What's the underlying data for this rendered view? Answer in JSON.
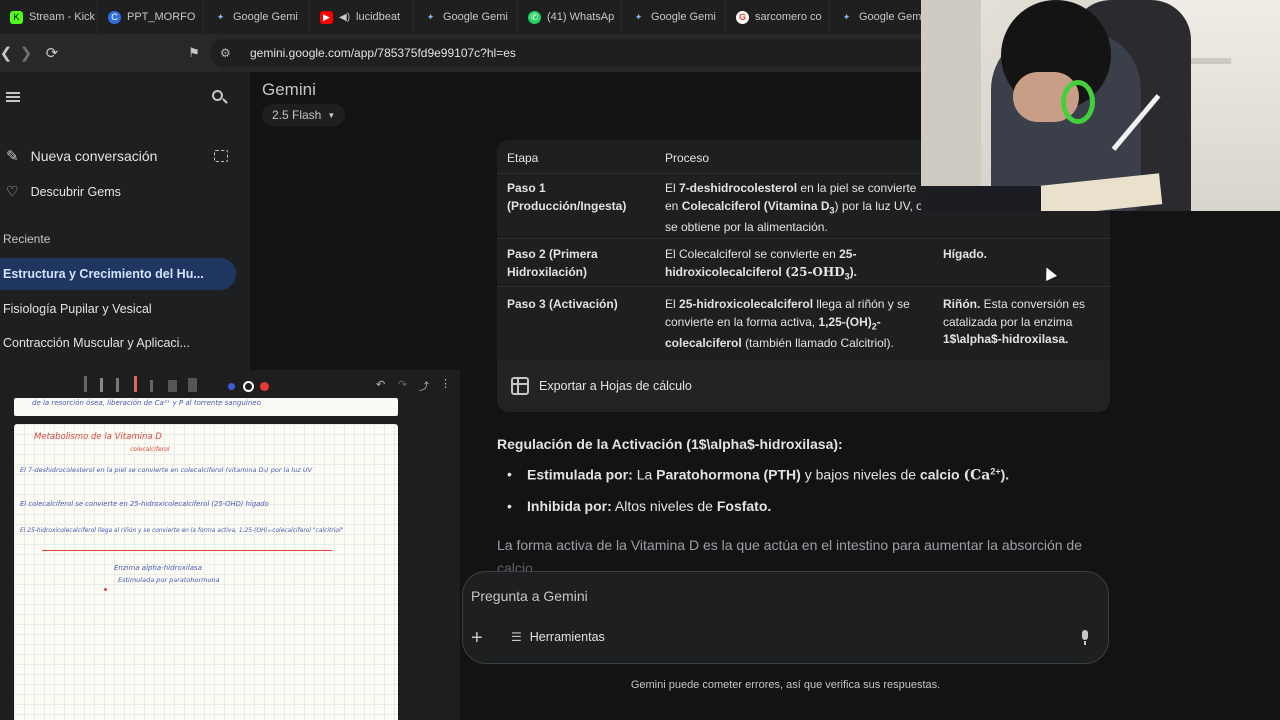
{
  "browser": {
    "tabs": [
      {
        "label": "Stream - Kick",
        "icon": "kick-icon",
        "color": "#53fc18"
      },
      {
        "label": "PPT_MORFO",
        "icon": "canva-icon",
        "color": "#2f6fe0"
      },
      {
        "label": "Google Gemi",
        "icon": "gemini-icon",
        "color": "#8ab4f8"
      },
      {
        "label": "lucidbeat",
        "icon": "youtube-icon",
        "color": "#ff0000"
      },
      {
        "label": "Google Gemi",
        "icon": "gemini-icon",
        "color": "#8ab4f8"
      },
      {
        "label": "(41) WhatsAp",
        "icon": "whatsapp-icon",
        "color": "#25d366"
      },
      {
        "label": "Google Gemi",
        "icon": "gemini-icon",
        "color": "#8ab4f8"
      },
      {
        "label": "sarcomero co",
        "icon": "google-icon",
        "color": "#ea4335"
      },
      {
        "label": "Google Gemi",
        "icon": "gemini-icon",
        "color": "#8ab4f8"
      }
    ],
    "url": "gemini.google.com/app/785375fd9e99107c?hl=es"
  },
  "sidebar": {
    "new_chat": "Nueva conversación",
    "discover": "Descubrir Gems",
    "recent_label": "Reciente",
    "recent": [
      {
        "label": "Estructura y Crecimiento del Hu...",
        "active": true
      },
      {
        "label": "Fisiología Pupilar y Vesical",
        "active": false
      },
      {
        "label": "Contracción Muscular y Aplicaci...",
        "active": false
      }
    ]
  },
  "header": {
    "title": "Gemini",
    "model": "2.5 Flash"
  },
  "table": {
    "headers": [
      "Etapa",
      "Proceso"
    ],
    "rows": [
      {
        "stage": "Paso 1 (Producción/Ingesta)",
        "process_bold1": "7-deshidrocolesterol",
        "process_pre": "El",
        "process_mid": "en la piel se convierte en",
        "process_bold2": "Colecalciferol (Vitamina D",
        "process_sub": "3",
        "process_end": ") por la luz UV, o se obtiene por la alimentación.",
        "location": ""
      },
      {
        "stage": "Paso 2 (Primera Hidroxilación)",
        "process_pre": "El Colecalciferol se convierte en",
        "process_bold1": "25-hidroxicolecalciferol",
        "process_formula": "(25-OHD",
        "process_sub": "3",
        "process_end": ").",
        "location": "Hígado."
      },
      {
        "stage": "Paso 3 (Activación)",
        "process_pre": "El",
        "process_bold1": "25-hidroxicolecalciferol",
        "process_mid": "llega al riñón y se convierte en la forma activa,",
        "process_bold2": "1,25-(OH)",
        "process_sub": "2",
        "process_bold3": "-colecalciferol",
        "process_end": "(también llamado Calcitriol).",
        "location_bold": "Riñón.",
        "location_rest": "Esta conversión es catalizada por la enzima",
        "location_enzyme": "1$\\alpha$-hidroxilasa."
      }
    ],
    "export_label": "Exportar a Hojas de cálculo"
  },
  "response": {
    "heading": "Regulación de la Activación (1$\\alpha$-hidroxilasa):",
    "bullet1_bold": "Estimulada por:",
    "bullet1_pre": "La",
    "bullet1_bold2": "Paratohormona (PTH)",
    "bullet1_mid": "y bajos niveles de",
    "bullet1_bold3": "calcio",
    "bullet1_formula": "(Ca",
    "bullet1_sup": "2+",
    "bullet1_end": ").",
    "bullet2_bold": "Inhibida por:",
    "bullet2_pre": "Altos niveles de",
    "bullet2_bold2": "Fosfato.",
    "closing": "La forma activa de la Vitamina D es la que actúa en el intestino para aumentar la absorción de",
    "closing2": "calcio"
  },
  "input": {
    "placeholder": "Pregunta a Gemini",
    "tools_label": "Herramientas"
  },
  "disclaimer": "Gemini puede cometer errores, así que verifica sus respuestas.",
  "notes": {
    "paper_top": "de la resorción ósea, liberación de Ca²⁺ y P al torrente sanguíneo",
    "lines": [
      {
        "text": "Metabolismo de la Vitamina D",
        "color": "red"
      },
      {
        "text": "colecalciferol",
        "color": "blue"
      },
      {
        "text": "El 7-deshidrocolesterol en la piel se convierte en colecalciferol (vitamina D₃) por la luz UV",
        "color": "blue"
      },
      {
        "text": "El colecalciferol se convierte en 25-hidroxicolecalciferol (25-OHD) hígado",
        "color": "blue"
      },
      {
        "text": "El 25-hidroxicolecalciferol llega al riñón y se convierte en la forma activa, 1,25-(OH)₂-colecalciferol \"calcitriol\"",
        "color": "blue"
      },
      {
        "text": "Enzima alpha-hidroxilasa",
        "color": "blue"
      },
      {
        "text": "Estimulada por paratohormona",
        "color": "blue"
      }
    ]
  }
}
